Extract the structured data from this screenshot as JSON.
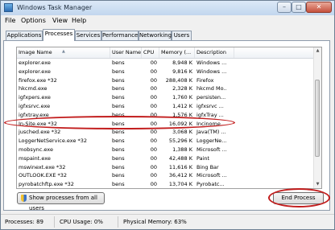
{
  "window": {
    "title": "Windows Task Manager"
  },
  "menu": [
    "File",
    "Options",
    "View",
    "Help"
  ],
  "tabs": [
    "Applications",
    "Processes",
    "Services",
    "Performance",
    "Networking",
    "Users"
  ],
  "active_tab": "Processes",
  "columns": [
    "Image Name",
    "User Name",
    "CPU",
    "Memory (...",
    "Description"
  ],
  "rows": [
    {
      "name": "explorer.exe",
      "user": "bens",
      "cpu": "00",
      "mem": "8,948 K",
      "desc": "Windows ..."
    },
    {
      "name": "explorer.exe",
      "user": "bens",
      "cpu": "00",
      "mem": "9,816 K",
      "desc": "Windows ..."
    },
    {
      "name": "firefox.exe *32",
      "user": "bens",
      "cpu": "00",
      "mem": "288,408 K",
      "desc": "Firefox"
    },
    {
      "name": "hkcmd.exe",
      "user": "bens",
      "cpu": "00",
      "mem": "2,328 K",
      "desc": "hkcmd Mo..."
    },
    {
      "name": "igfxpers.exe",
      "user": "bens",
      "cpu": "00",
      "mem": "1,760 K",
      "desc": "persisten..."
    },
    {
      "name": "igfxsrvc.exe",
      "user": "bens",
      "cpu": "00",
      "mem": "1,412 K",
      "desc": "igfxsrvc ..."
    },
    {
      "name": "igfxtray.exe",
      "user": "bens",
      "cpu": "00",
      "mem": "1,576 K",
      "desc": "igfxTray ..."
    },
    {
      "name": "In-Site.exe *32",
      "user": "bens",
      "cpu": "00",
      "mem": "16,092 K",
      "desc": "Incinome..."
    },
    {
      "name": "jusched.exe *32",
      "user": "bens",
      "cpu": "00",
      "mem": "3,068 K",
      "desc": "Java(TM) ..."
    },
    {
      "name": "LoggerNetService.exe *32",
      "user": "bens",
      "cpu": "00",
      "mem": "55,296 K",
      "desc": "LoggerNe..."
    },
    {
      "name": "mobsync.exe",
      "user": "bens",
      "cpu": "00",
      "mem": "1,388 K",
      "desc": "Microsoft ..."
    },
    {
      "name": "mspaint.exe",
      "user": "bens",
      "cpu": "00",
      "mem": "42,488 K",
      "desc": "Paint"
    },
    {
      "name": "mswinext.exe *32",
      "user": "bens",
      "cpu": "00",
      "mem": "11,616 K",
      "desc": "Bing Bar"
    },
    {
      "name": "OUTLOOK.EXE *32",
      "user": "bens",
      "cpu": "00",
      "mem": "36,412 K",
      "desc": "Microsoft ..."
    },
    {
      "name": "pyrobatchftp.exe *32",
      "user": "bens",
      "cpu": "00",
      "mem": "13,704 K",
      "desc": "Pyrobatc..."
    }
  ],
  "selected_row_name": "In-Site.exe *32",
  "buttons": {
    "show_all": "Show processes from all users",
    "end_process": "End Process"
  },
  "status": {
    "processes": "Processes: 89",
    "cpu": "CPU Usage: 0%",
    "memory": "Physical Memory: 63%"
  },
  "colors": {
    "highlight": "#c21d1d",
    "title_bar": "#c2d6ee"
  },
  "icons": {
    "app": "task-manager-icon",
    "shield": "uac-shield-icon"
  }
}
